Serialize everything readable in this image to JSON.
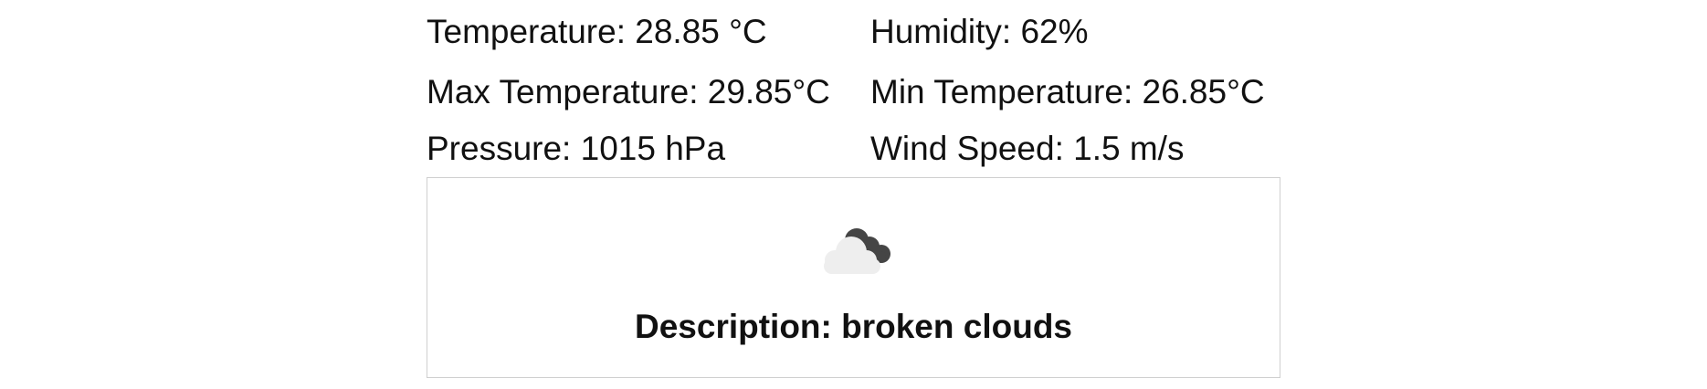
{
  "weather": {
    "temperature": "Temperature: 28.85 °C",
    "humidity": "Humidity: 62%",
    "max_temperature": "Max Temperature: 29.85°C",
    "min_temperature": "Min Temperature: 26.85°C",
    "pressure": "Pressure: 1015 hPa",
    "wind_speed": "Wind Speed: 1.5 m/s"
  },
  "card": {
    "icon": "broken-clouds-icon",
    "description": "Description: broken clouds"
  },
  "colors": {
    "text": "#111111",
    "border": "#cfcfcf",
    "cloud_dark": "#454545",
    "cloud_light": "#eeeeee"
  }
}
